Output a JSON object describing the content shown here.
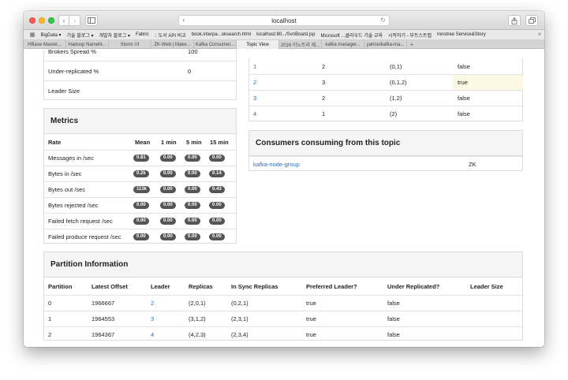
{
  "browser": {
    "address": "localhost",
    "bookmarks": [
      "BigData ▾",
      "기술 블로그 ▾",
      "개발자 블로그 ▾",
      "Fabric",
      ":: 도서 API 비교",
      "book.interpa...oksearch.html",
      "localhost:80.../SvnBoard.jsp",
      "Microsoft ...클라우드 기술 교육",
      "시작하기 - 부트스트랩",
      "Innotree Service&Story"
    ],
    "tabs": [
      "HBase Master...",
      "Hadoop NameN...",
      "Storm UI",
      "ZK-Web | Make...",
      "Kafka Consumer...",
      "Topic View",
      "2016 이노트리 제...",
      "kafka manager...",
      "yahoo/kafka-ma..."
    ],
    "active_tab": 5
  },
  "top_left": {
    "rows": [
      {
        "label": "Brokers Spread %",
        "value": "100"
      },
      {
        "label": "Under-replicated %",
        "value": "0"
      },
      {
        "label": "Leader Size",
        "value": ""
      }
    ]
  },
  "top_right": {
    "rows": [
      {
        "id": "1",
        "leader": "2",
        "replicas": "(0,1)",
        "under": "false"
      },
      {
        "id": "2",
        "leader": "3",
        "replicas": "(0,1,2)",
        "under": "true"
      },
      {
        "id": "3",
        "leader": "2",
        "replicas": "(1,2)",
        "under": "false"
      },
      {
        "id": "4",
        "leader": "1",
        "replicas": "(2)",
        "under": "false"
      }
    ]
  },
  "metrics": {
    "title": "Metrics",
    "headers": [
      "Rate",
      "Mean",
      "1 min",
      "5 min",
      "15 min"
    ],
    "rows": [
      {
        "rate": "Messages in /sec",
        "mean": "0.81",
        "m1": "0.00",
        "m5": "0.00",
        "m15": "0.00"
      },
      {
        "rate": "Bytes in /sec",
        "mean": "0.2k",
        "m1": "0.00",
        "m5": "0.00",
        "m15": "0.14"
      },
      {
        "rate": "Bytes out /sec",
        "mean": "113k",
        "m1": "0.00",
        "m5": "0.00",
        "m15": "0.43"
      },
      {
        "rate": "Bytes rejected /sec",
        "mean": "0.00",
        "m1": "0.00",
        "m5": "0.00",
        "m15": "0.00"
      },
      {
        "rate": "Failed fetch request /sec",
        "mean": "0.00",
        "m1": "0.00",
        "m5": "0.00",
        "m15": "0.00"
      },
      {
        "rate": "Failed produce request /sec",
        "mean": "0.00",
        "m1": "0.00",
        "m5": "0.00",
        "m15": "0.00"
      }
    ]
  },
  "consumers": {
    "title": "Consumers consuming from this topic",
    "rows": [
      {
        "group": "kafka-node-group",
        "type": "ZK"
      }
    ]
  },
  "partition_info": {
    "title": "Partition Information",
    "headers": [
      "Partition",
      "Latest Offset",
      "Leader",
      "Replicas",
      "In Sync Replicas",
      "Preferred Leader?",
      "Under Replicated?",
      "Leader Size"
    ],
    "rows": [
      {
        "partition": "0",
        "offset": "1966667",
        "leader": "2",
        "replicas": "(2,0,1)",
        "isr": "(0,2,1)",
        "preferred": "true",
        "under": "false",
        "size": ""
      },
      {
        "partition": "1",
        "offset": "1964553",
        "leader": "3",
        "replicas": "(3,1,2)",
        "isr": "(2,3,1)",
        "preferred": "true",
        "under": "false",
        "size": ""
      },
      {
        "partition": "2",
        "offset": "1964367",
        "leader": "4",
        "replicas": "(4,2,3)",
        "isr": "(2,3,4)",
        "preferred": "true",
        "under": "false",
        "size": ""
      }
    ]
  },
  "colors": {
    "link": "#2a6db5",
    "highlight": "#fcf8e3",
    "badge": "#555555"
  }
}
